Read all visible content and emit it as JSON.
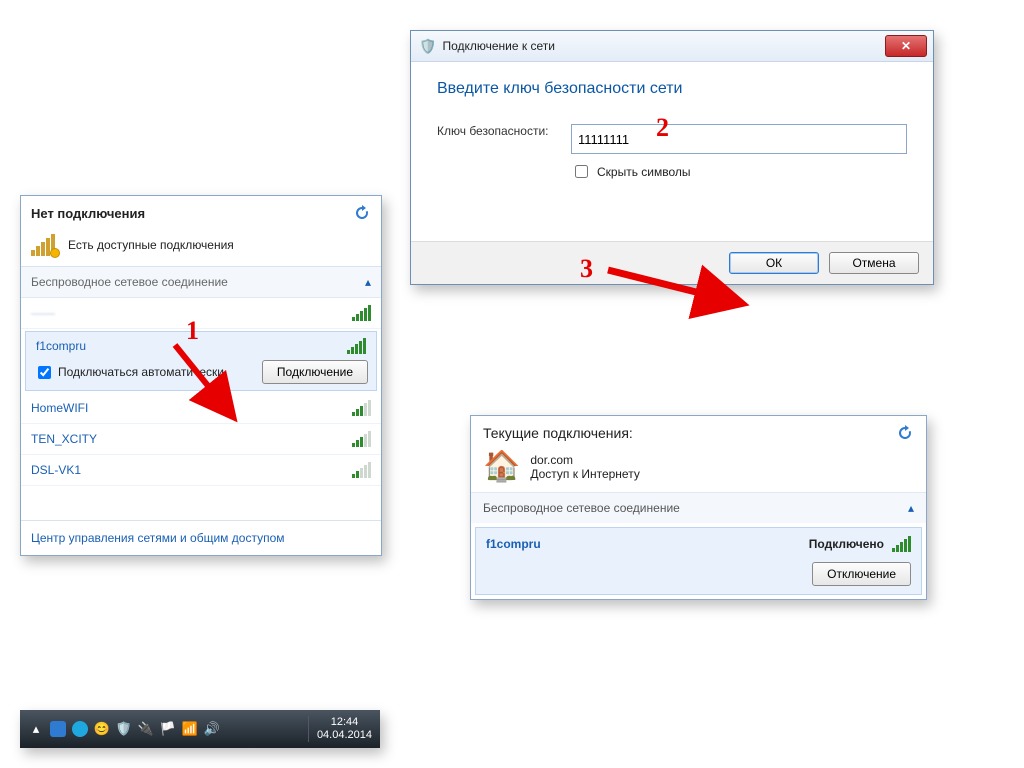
{
  "panel1": {
    "header": "Нет подключения",
    "available": "Есть доступные подключения",
    "section": "Беспроводное сетевое соединение",
    "blurred_name": "——",
    "selected": {
      "name": "f1compru",
      "auto_label": "Подключаться автоматически",
      "connect_btn": "Подключение"
    },
    "others": [
      "HomeWIFI",
      "TEN_XCITY",
      "DSL-VK1"
    ],
    "footer": "Центр управления сетями и общим доступом"
  },
  "taskbar": {
    "time": "12:44",
    "date": "04.04.2014"
  },
  "panel2": {
    "title": "Подключение к сети",
    "heading": "Введите ключ безопасности сети",
    "key_label": "Ключ безопасности:",
    "key_value": "11111111",
    "hide_label": "Скрыть символы",
    "ok": "ОК",
    "cancel": "Отмена"
  },
  "panel3": {
    "header": "Текущие подключения:",
    "domain": "dor.com",
    "access": "Доступ к Интернету",
    "section": "Беспроводное сетевое соединение",
    "conn_name": "f1compru",
    "conn_status": "Подключено",
    "disconnect": "Отключение"
  },
  "callouts": {
    "one": "1",
    "two": "2",
    "three": "3"
  }
}
